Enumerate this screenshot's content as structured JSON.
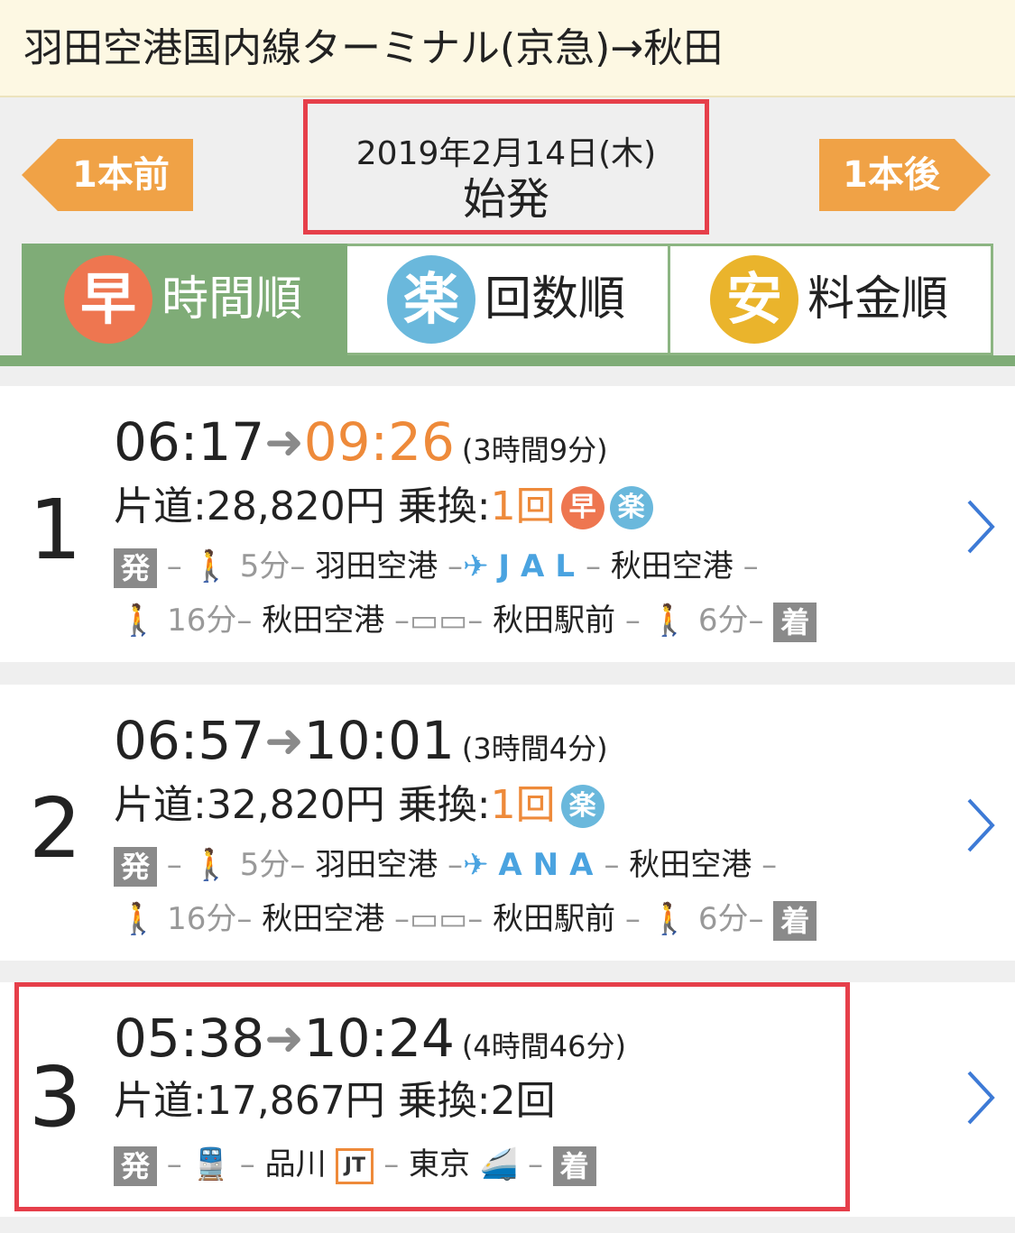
{
  "header": {
    "title": "羽田空港国内線ターミナル(京急)→秋田"
  },
  "nav": {
    "prev_label": "1本前",
    "next_label": "1本後",
    "date": "2019年2月14日(木)",
    "mode": "始発"
  },
  "colors": {
    "accent_orange": "#ee8a3a",
    "active_green": "#7fac77",
    "highlight_red": "#e63f4a",
    "badge_fast": "#ee7650",
    "badge_easy": "#6ab8dc",
    "badge_cheap": "#eab42c"
  },
  "sort_tabs": [
    {
      "badge": "早",
      "label": "時間順",
      "active": true
    },
    {
      "badge": "楽",
      "label": "回数順",
      "active": false
    },
    {
      "badge": "安",
      "label": "料金順",
      "active": false
    }
  ],
  "routes": [
    {
      "index": "1",
      "depart": "06:17",
      "arrive": "09:26",
      "duration": "(3時間9分)",
      "fare_label": "片道:",
      "fare": "28,820円",
      "transfer_label": "乗換:",
      "transfers": "1回",
      "badges": [
        "早",
        "楽"
      ],
      "line1": {
        "start": "発",
        "walk": "5分",
        "station1": "羽田空港",
        "carrier": "JAL",
        "station2": "秋田空港"
      },
      "line2": {
        "walk1": "16分",
        "station1": "秋田空港",
        "station2": "秋田駅前",
        "walk2": "6分",
        "end": "着"
      }
    },
    {
      "index": "2",
      "depart": "06:57",
      "arrive": "10:01",
      "duration": "(3時間4分)",
      "fare_label": "片道:",
      "fare": "32,820円",
      "transfer_label": "乗換:",
      "transfers": "1回",
      "badges": [
        "楽"
      ],
      "line1": {
        "start": "発",
        "walk": "5分",
        "station1": "羽田空港",
        "carrier": "ANA",
        "station2": "秋田空港"
      },
      "line2": {
        "walk1": "16分",
        "station1": "秋田空港",
        "station2": "秋田駅前",
        "walk2": "6分",
        "end": "着"
      }
    },
    {
      "index": "3",
      "depart": "05:38",
      "arrive": "10:24",
      "duration": "(4時間46分)",
      "fare_label": "片道:",
      "fare": "17,867円",
      "transfer_label": "乗換:",
      "transfers": "2回",
      "line1": {
        "start": "発",
        "station1": "品川",
        "jt": "JT",
        "station2": "東京",
        "end": "着"
      }
    }
  ]
}
